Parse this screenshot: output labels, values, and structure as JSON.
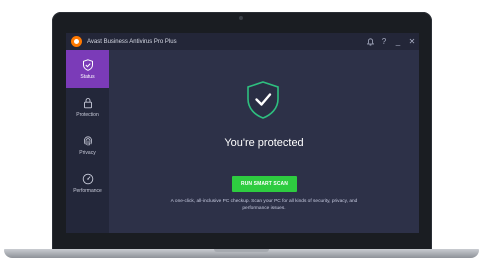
{
  "window": {
    "title": "Avast Business Antivirus Pro Plus",
    "controls": {
      "notifications_icon": "bell-icon",
      "help_label": "?",
      "minimize_label": "_",
      "close_label": "✕"
    }
  },
  "sidebar": {
    "items": [
      {
        "label": "Status",
        "icon": "shield-check-icon",
        "active": true
      },
      {
        "label": "Protection",
        "icon": "lock-icon",
        "active": false
      },
      {
        "label": "Privacy",
        "icon": "fingerprint-icon",
        "active": false
      },
      {
        "label": "Performance",
        "icon": "speedometer-icon",
        "active": false
      }
    ]
  },
  "main": {
    "status_title": "You're protected",
    "scan_button_label": "RUN SMART SCAN",
    "description": "A one-click, all-inclusive PC checkup. Scan your PC for all kinds of security, privacy, and performance issues."
  },
  "colors": {
    "accent_purple": "#7b3bb8",
    "scan_green": "#2ecc40",
    "shield_green": "#2ebf7f",
    "brand_orange": "#ff7800",
    "background": "#2d3148"
  }
}
